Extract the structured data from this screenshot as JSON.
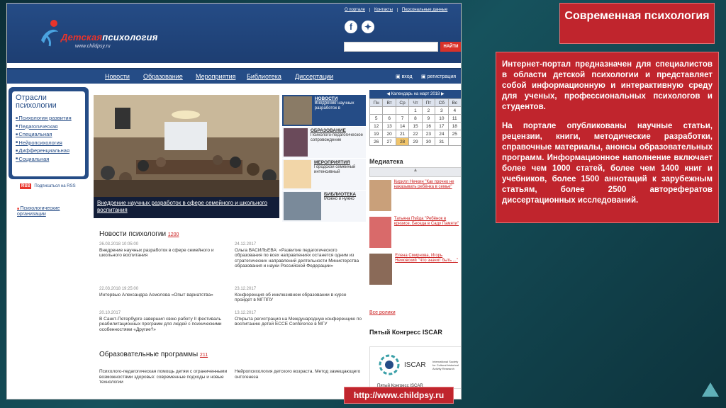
{
  "slide": {
    "title": "Современная психология",
    "paragraph1": "Интернет-портал предназначен для специалистов в области детской психологии и представляет собой информационную и интерактивную среду для ученых, профессиональных психологов и студентов.",
    "paragraph2": "На портале опубликованы научные статьи, рецензии, книги, методические разработки, справочные материалы, анонсы образовательных программ. Информационное наполнение включает более чем 1000 статей, более чем 1400 книг и учебников, более 1500 аннотаций к зарубежным статьям, более 2500 авторефератов диссертационных исследований.",
    "url": "http://www.childpsy.ru"
  },
  "site": {
    "logo_title_left": "Детская",
    "logo_title_right": "психология",
    "logo_url": "www.childpsy.ru",
    "top_links": [
      "О портале",
      "Контакты",
      "Персональные данные"
    ],
    "search_button": "НАЙТИ",
    "nav": [
      "Новости",
      "Образование",
      "Мероприятия",
      "Библиотека",
      "Диссертации"
    ],
    "login": "вход",
    "register": "регистрация",
    "branches_title": "Отрасли психологии",
    "branches": [
      "Психология развития",
      "Педагогическая",
      "Специальная",
      "Нейропсихология",
      "Дифференциальная",
      "Социальная"
    ],
    "rss_badge": "RSS",
    "rss_text": "Подписаться на RSS",
    "psych_orgs": "Психологические организации",
    "main_caption": "Внедрение научных разработок в сфере семейного и школьного воспитания",
    "side_news": [
      {
        "title": "НОВОСТИ",
        "text": "Внедрение научных разработок в"
      },
      {
        "title": "ОБРАЗОВАНИЕ",
        "text": "Психолого-педагогическое сопровождение"
      },
      {
        "title": "МЕРОПРИЯТИЯ",
        "text": "Городской семейный интенсивный"
      },
      {
        "title": "БИБЛИОТЕКА",
        "text": "Можно и нужно"
      }
    ],
    "calendar_title": "Календарь на март 2018",
    "calendar_days": [
      "Пн",
      "Вт",
      "Ср",
      "Чт",
      "Пт",
      "Сб",
      "Вс"
    ],
    "calendar_rows": [
      [
        "",
        "",
        "",
        "1",
        "2",
        "3",
        "4"
      ],
      [
        "5",
        "6",
        "7",
        "8",
        "9",
        "10",
        "11"
      ],
      [
        "12",
        "13",
        "14",
        "15",
        "16",
        "17",
        "18"
      ],
      [
        "19",
        "20",
        "21",
        "22",
        "23",
        "24",
        "25"
      ],
      [
        "26",
        "27",
        "28",
        "29",
        "30",
        "31",
        ""
      ]
    ],
    "calendar_selected": "28",
    "media_title": "Медиатека",
    "media": [
      {
        "text": "Кирилл Нечкин \"Как прочно не наказывать ребёнка в семье\""
      },
      {
        "text": "Татьяна Пуйда \"Ребёнок в кризисе. Беседа в Саду Памяти\""
      },
      {
        "text": "Елена Смирнова, Игорь Немовский \"Что значит быть ...\""
      }
    ],
    "news_title": "Новости психологии",
    "news_count": "1200",
    "news": [
      {
        "date": "26.03.2018 10:05:00",
        "text": "Внедрение научных разработок в сфере семейного и школьного воспитания"
      },
      {
        "date": "24.12.2017",
        "text": "Ольга ВАСИЛЬЕВА: «Развитие педагогического образования по всех направлениях останется одним из стратегических направлений деятельности Министерства образования и науки Российской Федерации»"
      },
      {
        "date": "22.03.2018 19:25:00",
        "text": "Интервью Александра Асмолова «Опыт вариатства»"
      },
      {
        "date": "23.12.2017",
        "text": "Конференция об инклюзивном образовании в курсе пройдет в МГППУ"
      },
      {
        "date": "20.10.2017",
        "text": "В Санкт-Петербурге завершил свою работу II фестиваль реабилитационных программ для людей с психическими особенностями «Другие?»"
      },
      {
        "date": "13.12.2017",
        "text": "Открыта регистрация на Международную конференцию по воспитанию детей ECCE Conference в МГУ"
      }
    ],
    "edu_title": "Образовательные программы",
    "edu_count": "211",
    "edu": [
      {
        "text": "Психолого-педагогическая помощь детям с ограниченными возможностями здоровья: современные подходы и новые технологии"
      },
      {
        "text": "Нейропсихология детского возраста. Метод замещающего онтогенеза"
      }
    ],
    "all_link": "Все ролики",
    "congress_title": "Пятый Конгресс ISCAR",
    "iscar_name": "ISCAR",
    "iscar_small": "International Society for Cultural-historical Activity Research",
    "iscar_bottom": "Пятый Конгресс ISCAR"
  }
}
